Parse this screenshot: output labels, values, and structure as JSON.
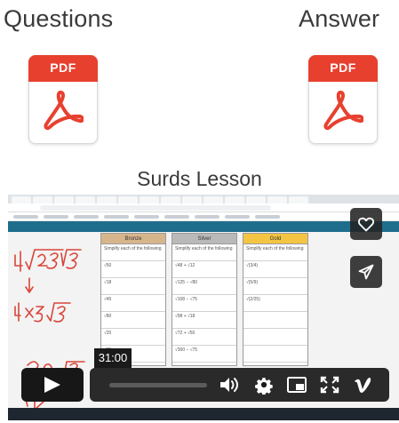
{
  "downloads": {
    "questions_heading": "Questions",
    "answer_heading": "Answer",
    "pdf_label": "PDF"
  },
  "lesson": {
    "title": "Surds Lesson"
  },
  "video": {
    "screen": {
      "columns": [
        {
          "header": "Bronze",
          "rows": [
            "Simplify each of the following",
            "√50",
            "√18",
            "√45",
            "√80",
            "√20",
            "√75"
          ]
        },
        {
          "header": "Silver",
          "rows": [
            "Simplify each of the following",
            "√48 + √12",
            "√125 − √80",
            "√108 − √75",
            "√98 + √18",
            "√72 + √50",
            "√300 − √75"
          ]
        },
        {
          "header": "Gold",
          "rows": [
            "Simplify each of the following",
            "√(3/4)",
            "√(5/9)",
            "√(2/25)",
            "",
            "",
            ""
          ]
        }
      ]
    },
    "time_label": "31:00",
    "progress": 0.0,
    "controls": {
      "play": "play-icon",
      "volume": "volume-icon",
      "settings": "gear-icon",
      "pip": "pip-icon",
      "fullscreen": "fullscreen-icon",
      "brand": "vimeo-icon"
    },
    "overlay": {
      "like": "heart-icon",
      "share": "paper-plane-icon"
    }
  },
  "colors": {
    "pdf_red": "#e8402e",
    "player_bg": "#171717",
    "bronze": "#d7b58c",
    "silver": "#b9b9b9",
    "gold": "#f4c542"
  }
}
